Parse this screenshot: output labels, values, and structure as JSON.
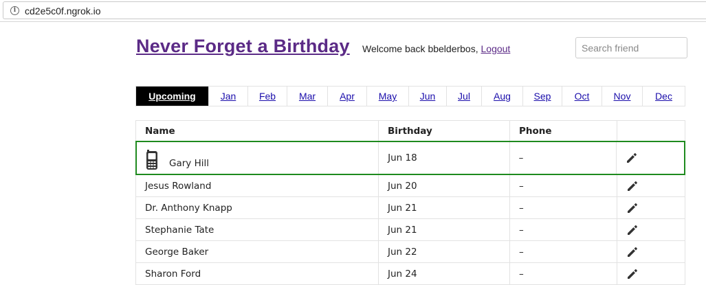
{
  "browser": {
    "url": "cd2e5c0f.ngrok.io",
    "info_icon": "info-icon"
  },
  "header": {
    "title": "Never Forget a Birthday",
    "welcome_text": "Welcome back bbelderbos,",
    "logout_label": "Logout",
    "search_placeholder": "Search friend"
  },
  "tabs": [
    "Upcoming",
    "Jan",
    "Feb",
    "Mar",
    "Apr",
    "May",
    "Jun",
    "Jul",
    "Aug",
    "Sep",
    "Oct",
    "Nov",
    "Dec"
  ],
  "active_tab": "Upcoming",
  "table": {
    "columns": [
      "Name",
      "Birthday",
      "Phone",
      ""
    ],
    "rows": [
      {
        "name": "Gary Hill",
        "birthday": "Jun 18",
        "phone": "–",
        "icon": "mobile-phone-icon",
        "highlight": true
      },
      {
        "name": "Jesus Rowland",
        "birthday": "Jun 20",
        "phone": "–"
      },
      {
        "name": "Dr. Anthony Knapp",
        "birthday": "Jun 21",
        "phone": "–"
      },
      {
        "name": "Stephanie Tate",
        "birthday": "Jun 21",
        "phone": "–"
      },
      {
        "name": "George Baker",
        "birthday": "Jun 22",
        "phone": "–"
      },
      {
        "name": "Sharon Ford",
        "birthday": "Jun 24",
        "phone": "–"
      }
    ]
  },
  "colors": {
    "title": "#5b2a86",
    "highlight_border": "#1e8a1e",
    "active_tab_bg": "#000000"
  }
}
